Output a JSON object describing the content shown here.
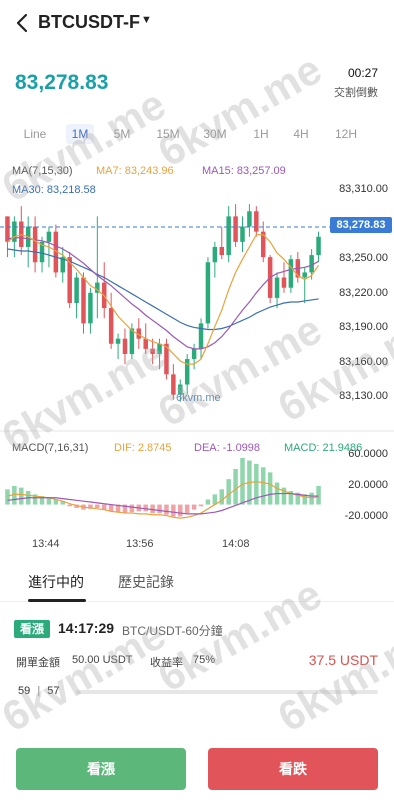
{
  "header": {
    "title": "BTCUSDT-F",
    "caret": "▼"
  },
  "price": "83,278.83",
  "countdown": "00:27",
  "settle_label": "交割倒數",
  "timeframes": [
    "Line",
    "1M",
    "5M",
    "15M",
    "30M",
    "1H",
    "4H",
    "12H"
  ],
  "active_timeframe": "1M",
  "ma": {
    "label": "MA(7,15,30)",
    "ma7": "MA7: 83,243.96",
    "ma15": "MA15: 83,257.09",
    "ma30": "MA30: 83,218.58"
  },
  "price_axis": [
    "83,310.00",
    "83,280.00",
    "83,250.00",
    "83,220.00",
    "83,190.00",
    "83,160.00",
    "83,130.00"
  ],
  "current_price_tag": "83,278.83",
  "macd": {
    "label": "MACD(7,16,31)",
    "dif": "DIF: 2.8745",
    "dea": "DEA: -1.0998",
    "macd": "MACD: 21.9486",
    "axis": [
      "60.0000",
      "20.0000",
      "-20.0000"
    ]
  },
  "time_axis": [
    "13:44",
    "13:56",
    "14:08"
  ],
  "tabs": {
    "active": "進行中的",
    "inactive": "歷史記錄"
  },
  "order": {
    "side": "看漲",
    "time": "14:17:29",
    "pair": "BTC/USDT-60分鐘",
    "amount_label": "開單金額",
    "amount": "50.00 USDT",
    "rate_label": "收益率",
    "rate": "75%",
    "profit": "37.5 USDT",
    "progress_left": "59",
    "progress_right": "57"
  },
  "buttons": {
    "up": "看漲",
    "down": "看跌"
  },
  "watermark": "6kvm.me",
  "colors": {
    "up": "#2bab7b",
    "down": "#e0545a",
    "accent": "#1aa1a8",
    "ma7": "#e8a33d",
    "ma15": "#9b59b6",
    "ma30": "#3a6fb0"
  },
  "chart_data": {
    "type": "candlestick",
    "ylim": [
      83110,
      83320
    ],
    "candles": [
      [
        83300,
        83300,
        83260,
        83275
      ],
      [
        83275,
        83300,
        83260,
        83295
      ],
      [
        83295,
        83310,
        83262,
        83270
      ],
      [
        83270,
        83300,
        83250,
        83290
      ],
      [
        83290,
        83300,
        83245,
        83255
      ],
      [
        83255,
        83280,
        83245,
        83275
      ],
      [
        83275,
        83290,
        83250,
        83285
      ],
      [
        83285,
        83292,
        83240,
        83245
      ],
      [
        83245,
        83270,
        83235,
        83260
      ],
      [
        83260,
        83265,
        83210,
        83215
      ],
      [
        83215,
        83245,
        83200,
        83240
      ],
      [
        83240,
        83245,
        83185,
        83195
      ],
      [
        83195,
        83230,
        83185,
        83225
      ],
      [
        83225,
        83300,
        83200,
        83235
      ],
      [
        83235,
        83255,
        83200,
        83210
      ],
      [
        83210,
        83225,
        83170,
        83175
      ],
      [
        83175,
        83185,
        83160,
        83180
      ],
      [
        83180,
        83190,
        83155,
        83165
      ],
      [
        83165,
        83195,
        83160,
        83190
      ],
      [
        83190,
        83200,
        83170,
        83180
      ],
      [
        83180,
        83195,
        83165,
        83170
      ],
      [
        83170,
        83180,
        83155,
        83165
      ],
      [
        83165,
        83180,
        83150,
        83175
      ],
      [
        83175,
        83180,
        83140,
        83145
      ],
      [
        83145,
        83155,
        83120,
        83125
      ],
      [
        83125,
        83140,
        83118,
        83135
      ],
      [
        83135,
        83165,
        83125,
        83160
      ],
      [
        83160,
        83175,
        83150,
        83170
      ],
      [
        83170,
        83200,
        83160,
        83195
      ],
      [
        83195,
        83260,
        83190,
        83255
      ],
      [
        83255,
        83275,
        83240,
        83270
      ],
      [
        83270,
        83290,
        83258,
        83262
      ],
      [
        83262,
        83310,
        83255,
        83300
      ],
      [
        83300,
        83312,
        83270,
        83275
      ],
      [
        83275,
        83300,
        83265,
        83290
      ],
      [
        83290,
        83312,
        83280,
        83305
      ],
      [
        83305,
        83310,
        83280,
        83285
      ],
      [
        83285,
        83295,
        83255,
        83260
      ],
      [
        83260,
        83262,
        83215,
        83220
      ],
      [
        83220,
        83245,
        83210,
        83240
      ],
      [
        83240,
        83255,
        83225,
        83230
      ],
      [
        83230,
        83262,
        83225,
        83258
      ],
      [
        83258,
        83265,
        83235,
        83240
      ],
      [
        83240,
        83250,
        83215,
        83245
      ],
      [
        83245,
        83268,
        83238,
        83262
      ],
      [
        83262,
        83285,
        83255,
        83280
      ]
    ],
    "ma7": [
      83275,
      83280,
      83282,
      83280,
      83276,
      83272,
      83270,
      83266,
      83262,
      83255,
      83248,
      83240,
      83232,
      83228,
      83222,
      83212,
      83202,
      83195,
      83188,
      83184,
      83180,
      83177,
      83175,
      83172,
      83165,
      83158,
      83155,
      83155,
      83160,
      83175,
      83192,
      83208,
      83228,
      83245,
      83258,
      83270,
      83282,
      83282,
      83275,
      83264,
      83258,
      83250,
      83242,
      83238,
      83242,
      83252
    ],
    "ma15": [
      83278,
      83279,
      83279,
      83278,
      83277,
      83276,
      83274,
      83271,
      83268,
      83264,
      83259,
      83254,
      83248,
      83242,
      83237,
      83232,
      83226,
      83220,
      83214,
      83209,
      83203,
      83198,
      83193,
      83188,
      83182,
      83177,
      83172,
      83170,
      83170,
      83172,
      83176,
      83182,
      83190,
      83199,
      83208,
      83216,
      83225,
      83233,
      83240,
      83244,
      83246,
      83248,
      83249,
      83250,
      83252,
      83256
    ],
    "ma30": [
      83268,
      83267,
      83266,
      83266,
      83265,
      83264,
      83262,
      83260,
      83258,
      83256,
      83253,
      83250,
      83247,
      83243,
      83240,
      83236,
      83232,
      83228,
      83224,
      83220,
      83216,
      83212,
      83208,
      83204,
      83200,
      83196,
      83193,
      83191,
      83190,
      83189,
      83189,
      83190,
      83192,
      83195,
      83198,
      83201,
      83205,
      83208,
      83211,
      83213,
      83215,
      83216,
      83216,
      83217,
      83218,
      83219
    ],
    "macd_ylim": [
      -30,
      62
    ],
    "macd_hist": [
      18,
      22,
      20,
      16,
      12,
      10,
      9,
      6,
      4,
      -2,
      -4,
      -6,
      -5,
      -4,
      -6,
      -8,
      -9,
      -10,
      -9,
      -8,
      -8,
      -10,
      -10,
      -12,
      -14,
      -14,
      -10,
      -6,
      -2,
      6,
      12,
      18,
      30,
      42,
      55,
      52,
      48,
      44,
      38,
      26,
      20,
      16,
      14,
      12,
      14,
      22
    ],
    "macd_dif": [
      10,
      12,
      12,
      11,
      10,
      9,
      8,
      6,
      4,
      1,
      -1,
      -3,
      -4,
      -5,
      -6,
      -8,
      -9,
      -10,
      -10,
      -11,
      -11,
      -12,
      -12,
      -13,
      -15,
      -16,
      -15,
      -13,
      -10,
      -5,
      0,
      5,
      12,
      18,
      24,
      26,
      27,
      26,
      24,
      19,
      16,
      13,
      11,
      9,
      8,
      9
    ],
    "macd_dea": [
      5,
      6,
      7,
      8,
      8,
      8,
      8,
      8,
      7,
      6,
      5,
      4,
      3,
      2,
      1,
      0,
      -1,
      -2,
      -3,
      -4,
      -5,
      -6,
      -7,
      -8,
      -9,
      -10,
      -11,
      -11,
      -11,
      -10,
      -9,
      -7,
      -4,
      -1,
      2,
      5,
      8,
      10,
      12,
      13,
      13,
      13,
      12,
      11,
      10,
      10
    ]
  }
}
